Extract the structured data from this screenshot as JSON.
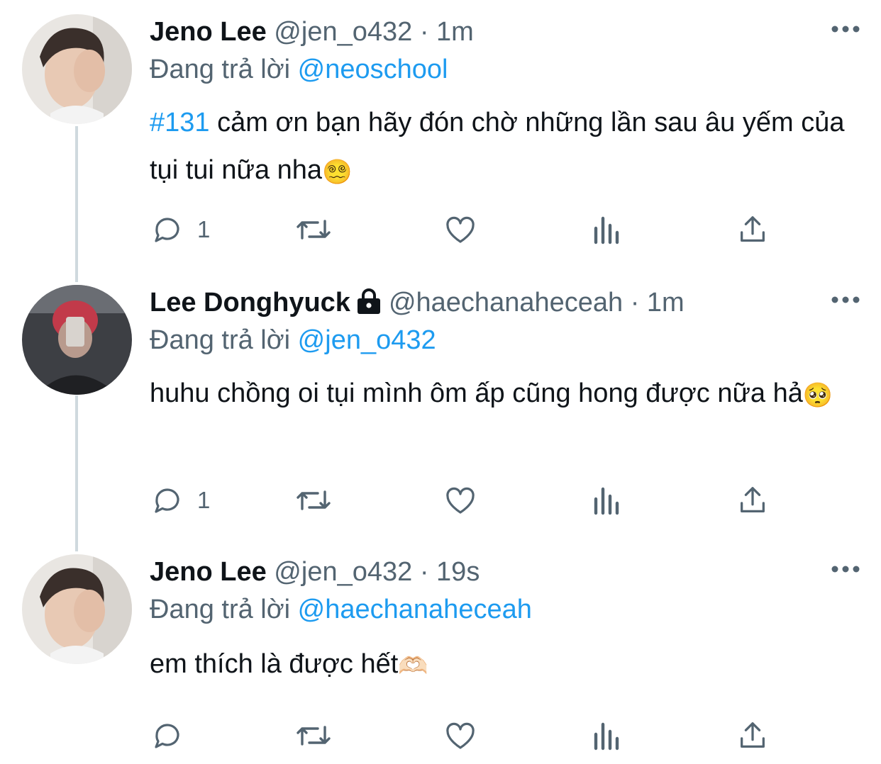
{
  "tweets": [
    {
      "name": "Jeno Lee",
      "handle": "@jen_o432",
      "sep": "·",
      "time": "1m",
      "locked": false,
      "replying_prefix": "Đang trả lời",
      "replying_to": "@neoschool",
      "hashtag": "#131",
      "text": " cảm ơn bạn hãy đón chờ những lần sau âu yếm của tụi tui nữa nha",
      "emoji": "😵‍💫",
      "reply_count": "1",
      "avatar": "avatar-jeno"
    },
    {
      "name": "Lee Donghyuck",
      "handle": "@haechanaheceah",
      "sep": "·",
      "time": "1m",
      "locked": true,
      "replying_prefix": "Đang trả lời",
      "replying_to": "@jen_o432",
      "hashtag": "",
      "text": "huhu chồng oi tụi mình ôm ấp cũng hong được nữa hả",
      "emoji": "🥺",
      "reply_count": "1",
      "avatar": "avatar-donghyuck"
    },
    {
      "name": "Jeno Lee",
      "handle": "@jen_o432",
      "sep": "·",
      "time": "19s",
      "locked": false,
      "replying_prefix": "Đang trả lời",
      "replying_to": "@haechanaheceah",
      "hashtag": "",
      "text": "em thích là được hết",
      "emoji": "🫶🏻",
      "reply_count": "",
      "avatar": "avatar-jeno"
    }
  ],
  "icons": {
    "reply": "reply-icon",
    "retweet": "retweet-icon",
    "like": "heart-icon",
    "views": "analytics-icon",
    "share": "share-icon",
    "more": "more-icon",
    "lock": "lock-icon"
  },
  "colors": {
    "accent": "#1d9bf0",
    "secondary_text": "#536471",
    "thread_line": "#cfd9de"
  }
}
